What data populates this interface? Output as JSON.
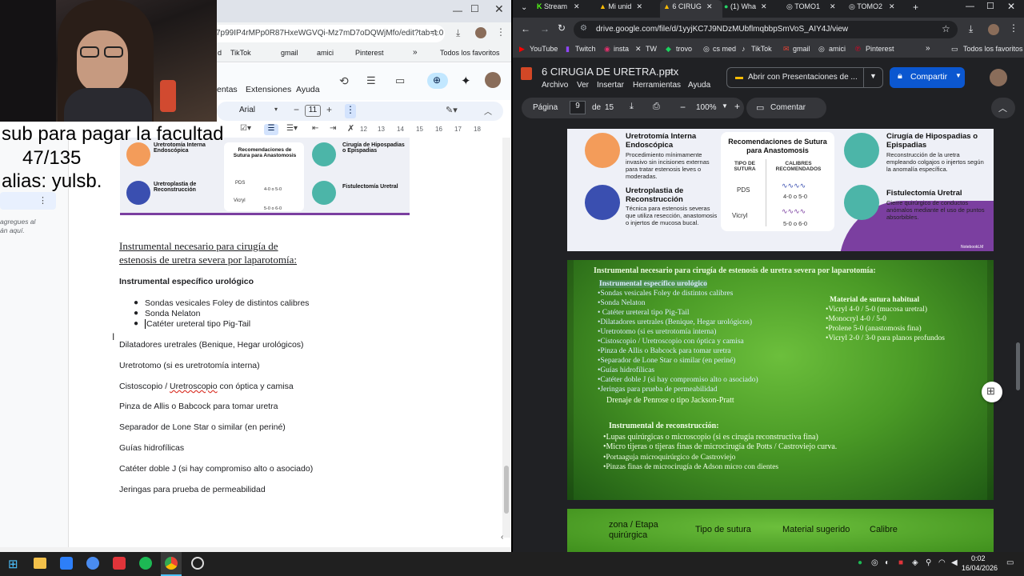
{
  "left_window": {
    "url": "7p99IP4rMPp0R87HxeWGVQi-Mz7mD7oDQWjMfo/edit?tab=t.0",
    "bookmarks": [
      "d",
      "TikTok",
      "gmail",
      "amici",
      "Pinterest"
    ],
    "bookmarks_more": "»",
    "favorites": "Todos los favoritos",
    "menu": [
      "entas",
      "Extensiones",
      "Ayuda"
    ],
    "font": "Arial",
    "font_size": "11",
    "ruler": [
      "12",
      "13",
      "14",
      "15",
      "16",
      "17",
      "18"
    ],
    "comment_hint_1": "agregues al",
    "comment_hint_2": "án aquí.",
    "heading_line1": "Instrumental necesario para cirugía de",
    "heading_line2": "estenosis de uretra severa por laparotomía:",
    "subheading": "Instrumental específico urológico",
    "bullets": [
      "Sondas vesicales Foley de distintos calibres",
      "Sonda Nelaton",
      "Catéter ureteral tipo Pig-Tail"
    ],
    "lines": [
      "Dilatadores uretrales (Benique, Hegar urológicos)",
      "Uretrotomo (si es uretrotomía interna)",
      "Cistoscopio / Uretroscopio con óptica y camisa",
      "Pinza de Allis o Babcock para tomar uretra",
      "Separador de Lone Star o similar (en periné)",
      "Guías hidrofílicas",
      "Catéter doble J (si hay compromiso alto o asociado)",
      "Jeringas para prueba de permeabilidad"
    ],
    "uretroscopio_word": "Uretroscopio"
  },
  "overlay": {
    "line1": "sub para pagar la facultad",
    "line2": "47/135",
    "line3": "alias: yulsb."
  },
  "infographic": {
    "a_title": "Uretrotomía Interna Endoscópica",
    "a_desc": "Procedimiento mínimamente invasivo sin incisiones externas para tratar estenosis leves o moderadas.",
    "b_title": "Uretroplastia de Reconstrucción",
    "b_desc": "Técnica para estenosis severas que utiliza resección, anastomosis o injertos de mucosa bucal.",
    "c_title": "Recomendaciones de Sutura para Anastomosis",
    "c_col1": "TIPO DE SUTURA",
    "c_col2": "CALIBRES RECOMENDADOS",
    "c_row1": "PDS",
    "c_row1_val": "4-0 o 5-0",
    "c_row2": "Vicryl",
    "c_row2_val": "5-0 o 6-0",
    "d_title": "Cirugía de Hipospadias o Epispadias",
    "d_desc": "Reconstrucción de la uretra empleando colgajos o injertos según la anomalía específica.",
    "e_title": "Fistulectomía Uretral",
    "e_desc": "Cierre quirúrgico de conductos anómalos mediante el uso de puntos absorbibles.",
    "watermark": "NotebookLM"
  },
  "right_window": {
    "tabs": [
      "Stream",
      "Mi unid",
      "6 CIRUG",
      "(1) Wha",
      "TOMO1",
      "TOMO2"
    ],
    "url": "drive.google.com/file/d/1yyjKC7J9NDzMUbflmqbbpSmVoS_AIY4J/view",
    "bookmarks": [
      "YouTube",
      "Twitch",
      "insta",
      "TW",
      "trovo",
      "cs med",
      "TikTok",
      "gmail",
      "amici",
      "Pinterest"
    ],
    "favorites": "Todos los favoritos",
    "file_title": "6 CIRUGIA DE URETRA.pptx",
    "menu": [
      "Archivo",
      "Ver",
      "Insertar",
      "Herramientas",
      "Ayuda"
    ],
    "open_with": "Abrir con Presentaciones de ...",
    "share": "Compartir",
    "page_label": "Página",
    "page_num": "9",
    "page_of": "de",
    "page_total": "15",
    "zoom": "100%",
    "comment": "Comentar"
  },
  "slide2": {
    "title": "Instrumental necesario para cirugía de estenosis de uretra severa por laparotomía:",
    "sub": "Instrumental específico urológico",
    "items": [
      "•Sondas vesicales Foley de distintos calibres",
      "•Sonda Nelaton",
      "• Catéter ureteral tipo Pig-Tail",
      "•Dilatadores uretrales (Benique, Hegar urológicos)",
      "•Uretrotomo (si es uretrotomía interna)",
      "•Cistoscopio / Uretroscopio con óptica y camisa",
      "•Pinza de Allis o Babcock para tomar uretra",
      "•Separador de Lone Star o similar (en periné)",
      "•Guías hidrofílicas",
      "•Catéter doble J (si hay compromiso alto o asociado)",
      "•Jeringas para prueba de permeabilidad"
    ],
    "drain": "Drenaje de Penrose o tipo Jackson-Pratt",
    "suture_title": "Material de sutura habitual",
    "sutures": [
      "•Vicryl 4-0 / 5-0 (mucosa uretral)",
      "•Monocryl 4-0 / 5-0",
      "•Prolene 5-0 (anastomosis fina)",
      "•Vicryl 2-0 / 3-0 para planos profundos"
    ],
    "recon_title": "Instrumental de reconstrucción:",
    "recon": [
      "•Lupas quirúrgicas o microscopio (si es cirugía reconstructiva fina)",
      "•Micro tijeras o tijeras finas de microcirugía de Potts / Castroviejo curva.",
      "•Portaaguja microquirúrgico de Castroviejo",
      "•Pinzas finas de microcirugía de Adson micro con dientes"
    ]
  },
  "slide3": {
    "h1": "zona / Etapa quirúrgica",
    "h2": "Tipo de sutura",
    "h3": "Material sugerido",
    "h4": "Calibre"
  },
  "taskbar": {
    "time": "0:02",
    "date": "16/04/2026"
  },
  "colors": {
    "chrome_dark": "#202124",
    "green_slide": "#3e8e1c",
    "accent_blue": "#1a73e8"
  }
}
